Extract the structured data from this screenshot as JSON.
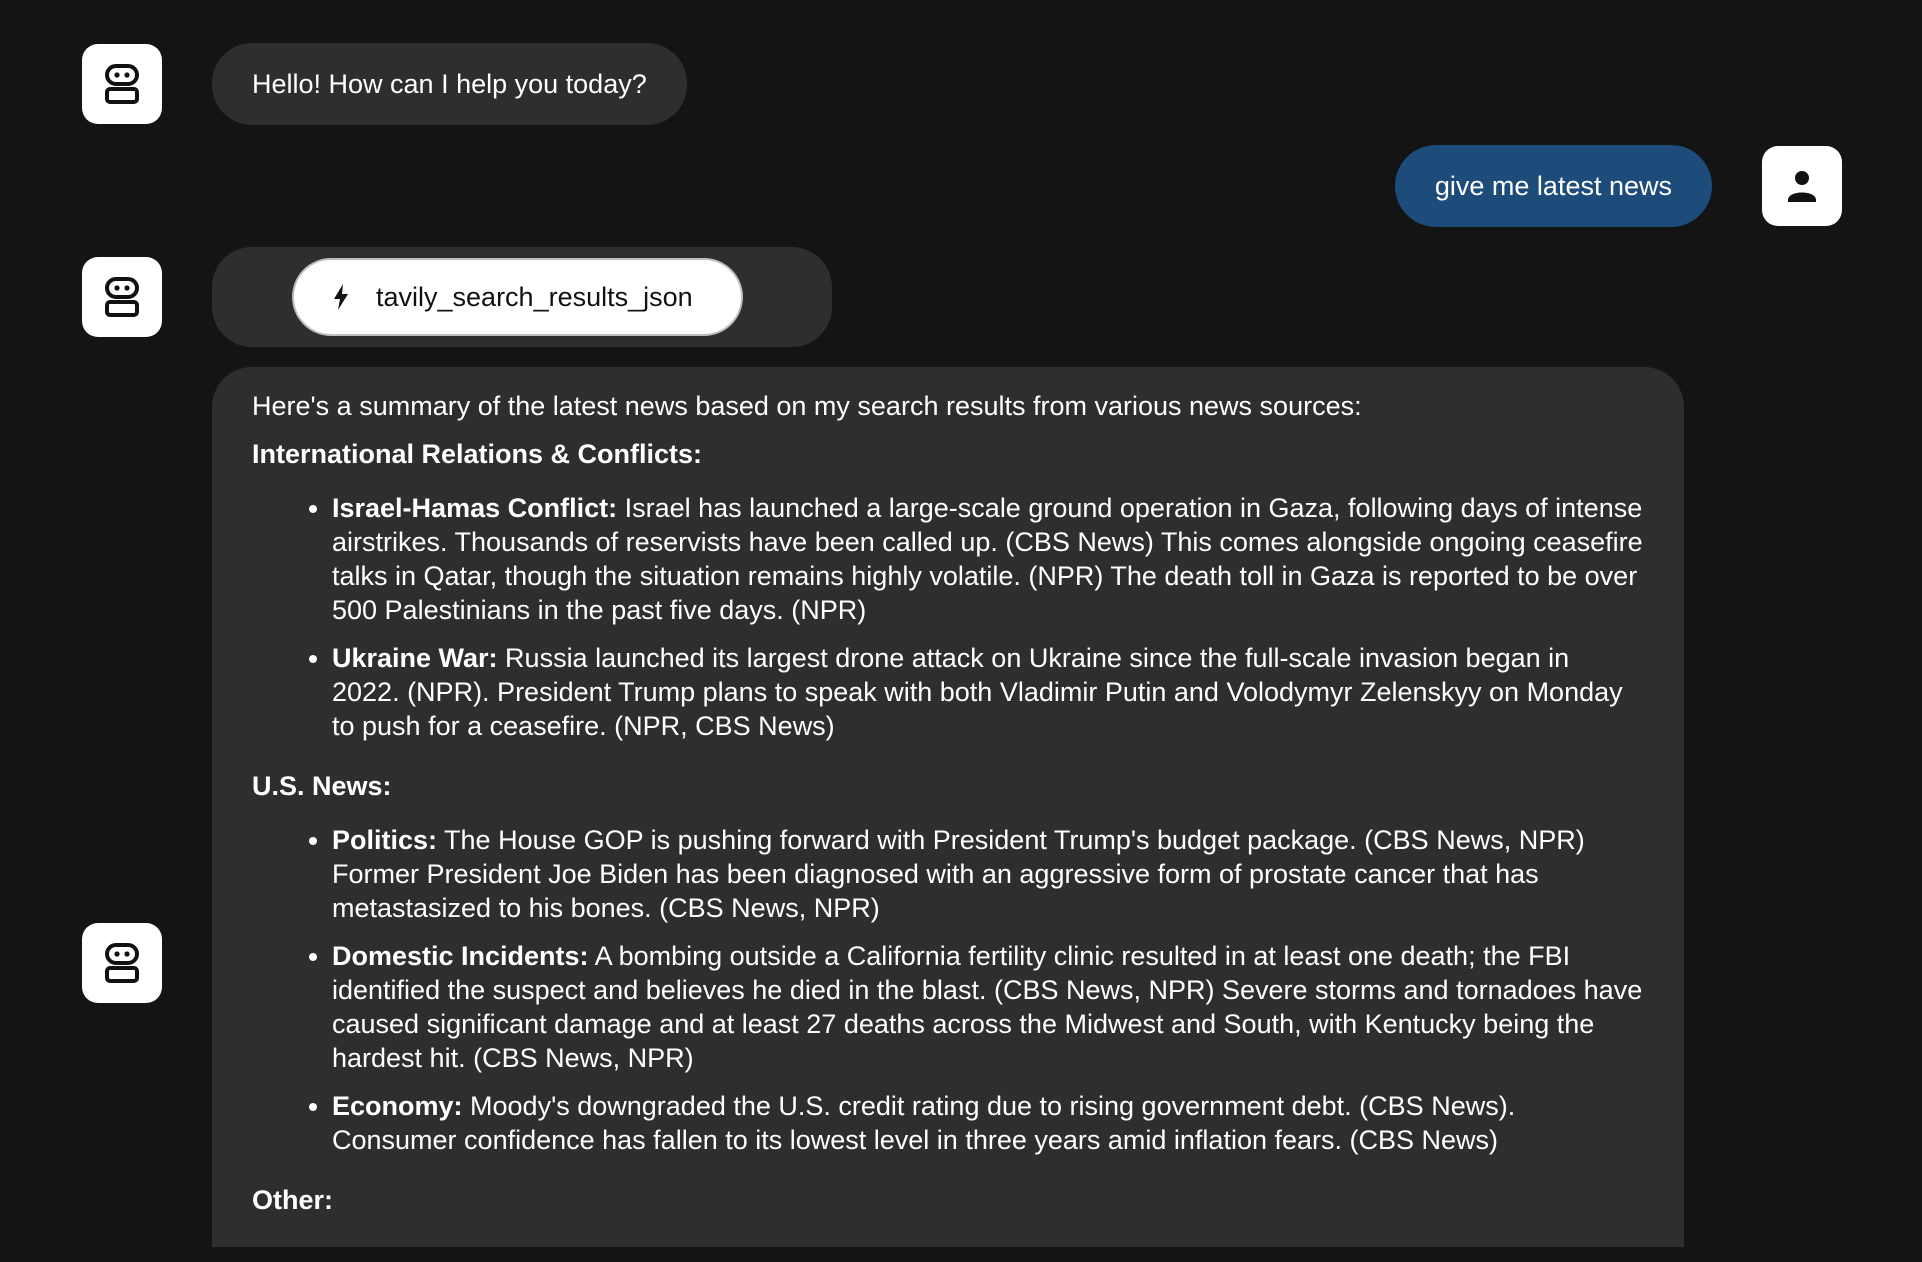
{
  "chat": {
    "greeting": "Hello! How can I help you today?",
    "user_message": "give me latest news",
    "tool_call": {
      "icon": "lightning-bolt-icon",
      "name": "tavily_search_results_json"
    },
    "assistant_icon": "robot-icon",
    "user_icon": "person-icon",
    "answer": {
      "intro": "Here's a summary of the latest news based on my search results from various news sources:",
      "sections": [
        {
          "heading": "International Relations & Conflicts:",
          "items": [
            {
              "title": "Israel-Hamas Conflict:",
              "text": " Israel has launched a large-scale ground operation in Gaza, following days of intense airstrikes. Thousands of reservists have been called up. (CBS News) This comes alongside ongoing ceasefire talks in Qatar, though the situation remains highly volatile. (NPR) The death toll in Gaza is reported to be over 500 Palestinians in the past five days. (NPR)"
            },
            {
              "title": "Ukraine War:",
              "text": " Russia launched its largest drone attack on Ukraine since the full-scale invasion began in 2022. (NPR). President Trump plans to speak with both Vladimir Putin and Volodymyr Zelenskyy on Monday to push for a ceasefire. (NPR, CBS News)"
            }
          ]
        },
        {
          "heading": "U.S. News:",
          "items": [
            {
              "title": "Politics:",
              "text": " The House GOP is pushing forward with President Trump's budget package. (CBS News, NPR) Former President Joe Biden has been diagnosed with an aggressive form of prostate cancer that has metastasized to his bones. (CBS News, NPR)"
            },
            {
              "title": "Domestic Incidents:",
              "text": " A bombing outside a California fertility clinic resulted in at least one death; the FBI identified the suspect and believes he died in the blast. (CBS News, NPR) Severe storms and tornadoes have caused significant damage and at least 27 deaths across the Midwest and South, with Kentucky being the hardest hit. (CBS News, NPR)"
            },
            {
              "title": "Economy:",
              "text": " Moody's downgraded the U.S. credit rating due to rising government debt. (CBS News). Consumer confidence has fallen to its lowest level in three years amid inflation fears. (CBS News)"
            }
          ]
        },
        {
          "heading": "Other:",
          "items": []
        }
      ]
    }
  },
  "colors": {
    "background": "#141414",
    "assistant_bubble": "#2e2e2e",
    "user_bubble": "#1d4b7a",
    "avatar_bg": "#ffffff"
  }
}
